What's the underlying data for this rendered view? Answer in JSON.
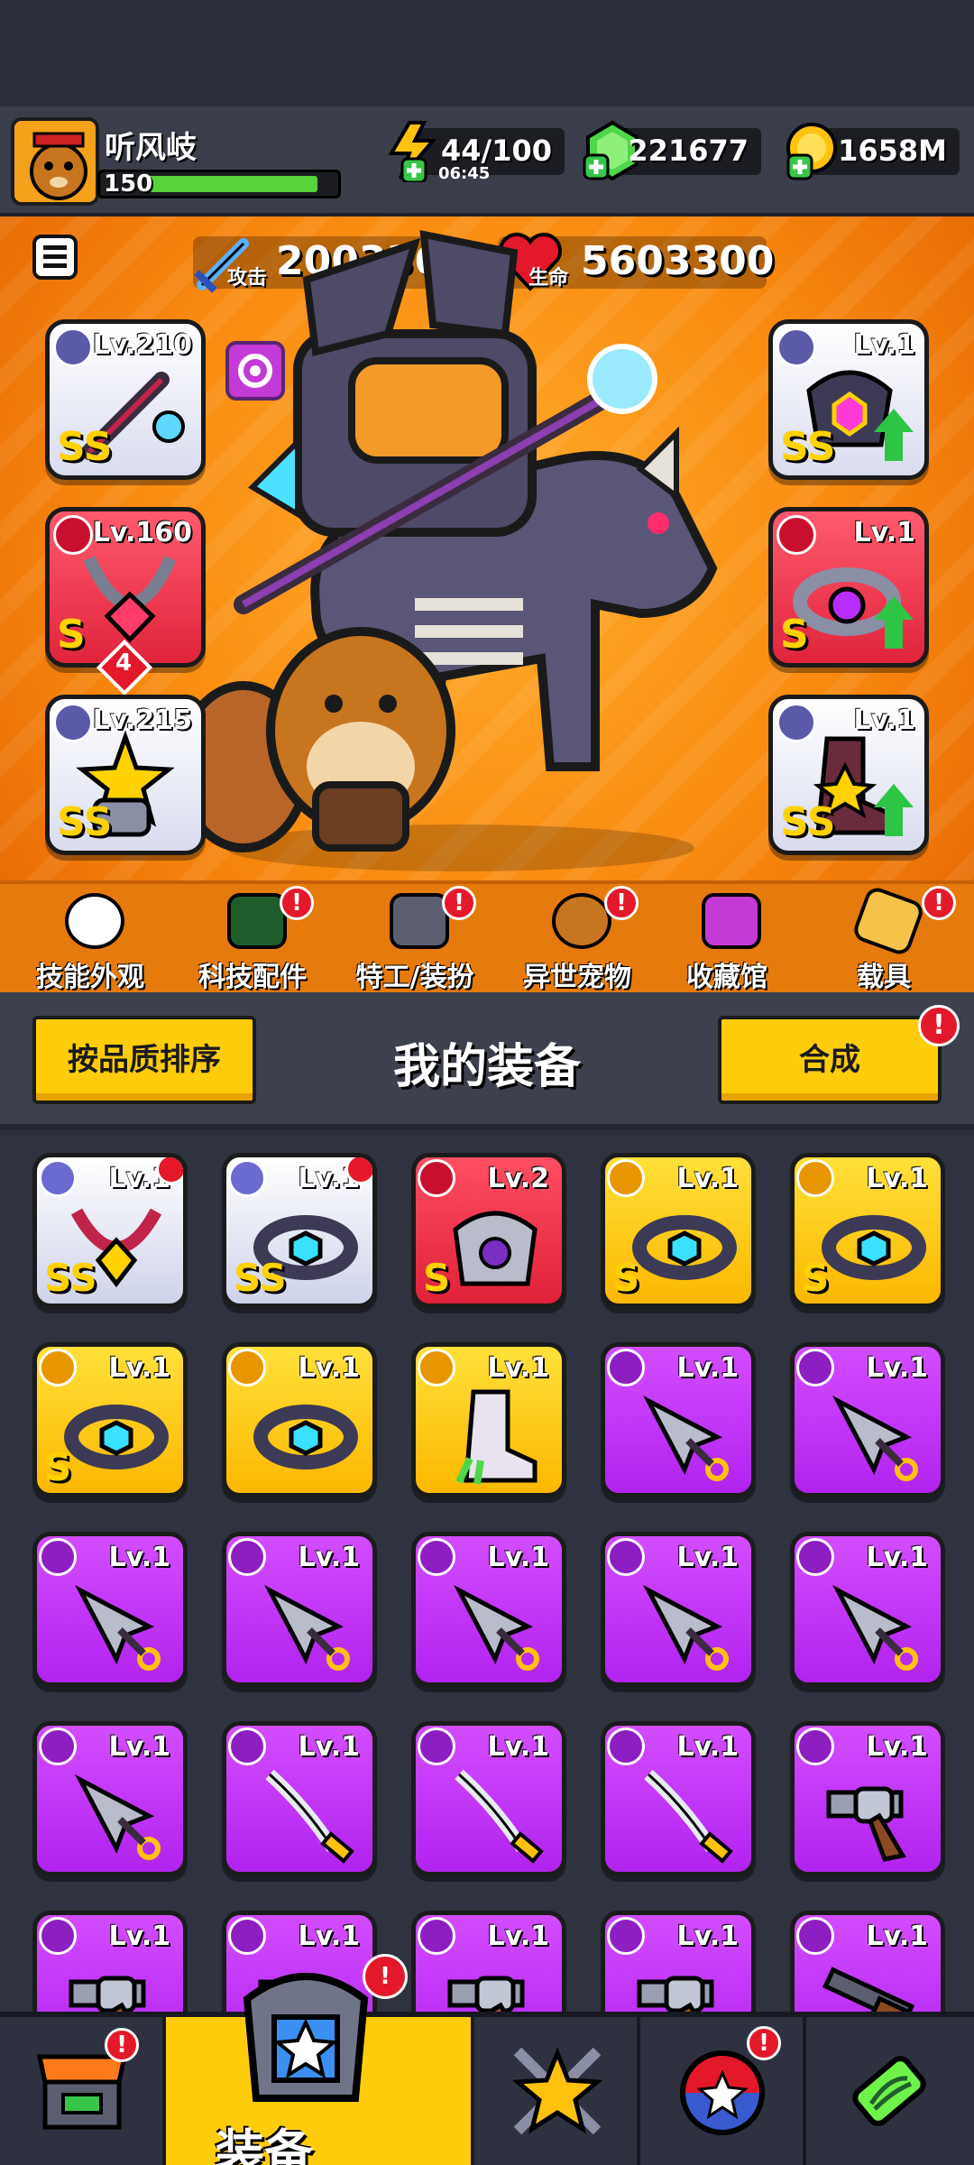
{
  "player": {
    "name": "听风岐",
    "level": "150",
    "xp_fill": 0.9
  },
  "resources": {
    "energy": {
      "value": "44/100",
      "timer": "06:45"
    },
    "gems": {
      "value": "221677"
    },
    "coins": {
      "value": "1658M"
    }
  },
  "stats": {
    "attack": {
      "label": "攻击",
      "value": "2003364"
    },
    "health": {
      "label": "生命",
      "value": "5603300"
    }
  },
  "equipped": {
    "left": [
      {
        "level": "Lv.210",
        "grade": "SS",
        "rarity": "silver",
        "icon": "weapon-staff-icon"
      },
      {
        "level": "Lv.160",
        "grade": "S",
        "rarity": "red",
        "icon": "necklace-icon",
        "stars": "4"
      },
      {
        "level": "Lv.215",
        "grade": "SS",
        "rarity": "silver",
        "icon": "glove-icon"
      }
    ],
    "right": [
      {
        "level": "Lv.1",
        "grade": "SS",
        "rarity": "silver",
        "icon": "armor-icon",
        "upgrade": true
      },
      {
        "level": "Lv.1",
        "grade": "S",
        "rarity": "red",
        "icon": "belt-icon",
        "upgrade": true
      },
      {
        "level": "Lv.1",
        "grade": "SS",
        "rarity": "silver",
        "icon": "boot-icon",
        "upgrade": true
      }
    ]
  },
  "feature_tabs": [
    {
      "label": "技能外观",
      "icon": "skill-skin-icon",
      "badge": false
    },
    {
      "label": "科技配件",
      "icon": "tech-part-icon",
      "badge": true
    },
    {
      "label": "特工/装扮",
      "icon": "agent-costume-icon",
      "badge": true
    },
    {
      "label": "异世宠物",
      "icon": "pet-icon",
      "badge": true
    },
    {
      "label": "收藏馆",
      "icon": "collection-chest-icon",
      "badge": false
    },
    {
      "label": "载具",
      "icon": "vehicle-icon",
      "badge": true
    }
  ],
  "equipment_panel": {
    "sort_button": "按品质排序",
    "title": "我的装备",
    "merge_button": "合成"
  },
  "inventory": [
    {
      "level": "Lv.1",
      "rarity": "silver",
      "grade": "SS",
      "icon": "necklace-icon",
      "new": true
    },
    {
      "level": "Lv.1",
      "rarity": "silver",
      "grade": "SS",
      "icon": "belt-icon",
      "new": true
    },
    {
      "level": "Lv.2",
      "rarity": "red",
      "grade": "S",
      "icon": "armor-icon",
      "new": false
    },
    {
      "level": "Lv.1",
      "rarity": "gold",
      "grade": "S",
      "icon": "belt-icon",
      "new": false
    },
    {
      "level": "Lv.1",
      "rarity": "gold",
      "grade": "S",
      "icon": "belt-icon",
      "new": false
    },
    {
      "level": "Lv.1",
      "rarity": "gold",
      "grade": "S",
      "icon": "belt-icon",
      "new": false
    },
    {
      "level": "Lv.1",
      "rarity": "gold",
      "grade": "",
      "icon": "belt-icon",
      "new": false
    },
    {
      "level": "Lv.1",
      "rarity": "gold",
      "grade": "",
      "icon": "boot-icon",
      "new": false
    },
    {
      "level": "Lv.1",
      "rarity": "purple",
      "grade": "",
      "icon": "kunai-icon",
      "new": false
    },
    {
      "level": "Lv.1",
      "rarity": "purple",
      "grade": "",
      "icon": "kunai-icon",
      "new": false
    },
    {
      "level": "Lv.1",
      "rarity": "purple",
      "grade": "",
      "icon": "kunai-icon",
      "new": false
    },
    {
      "level": "Lv.1",
      "rarity": "purple",
      "grade": "",
      "icon": "kunai-icon",
      "new": false
    },
    {
      "level": "Lv.1",
      "rarity": "purple",
      "grade": "",
      "icon": "kunai-icon",
      "new": false
    },
    {
      "level": "Lv.1",
      "rarity": "purple",
      "grade": "",
      "icon": "kunai-icon",
      "new": false
    },
    {
      "level": "Lv.1",
      "rarity": "purple",
      "grade": "",
      "icon": "kunai-icon",
      "new": false
    },
    {
      "level": "Lv.1",
      "rarity": "purple",
      "grade": "",
      "icon": "kunai-icon",
      "new": false
    },
    {
      "level": "Lv.1",
      "rarity": "purple",
      "grade": "",
      "icon": "saber-icon",
      "new": false
    },
    {
      "level": "Lv.1",
      "rarity": "purple",
      "grade": "",
      "icon": "saber-icon",
      "new": false
    },
    {
      "level": "Lv.1",
      "rarity": "purple",
      "grade": "",
      "icon": "saber-icon",
      "new": false
    },
    {
      "level": "Lv.1",
      "rarity": "purple",
      "grade": "",
      "icon": "revolver-icon",
      "new": false
    },
    {
      "level": "Lv.1",
      "rarity": "purple",
      "grade": "",
      "icon": "revolver-icon",
      "new": false
    },
    {
      "level": "Lv.1",
      "rarity": "purple",
      "grade": "",
      "icon": "revolver-icon",
      "new": false
    },
    {
      "level": "Lv.1",
      "rarity": "purple",
      "grade": "",
      "icon": "revolver-icon",
      "new": false
    },
    {
      "level": "Lv.1",
      "rarity": "purple",
      "grade": "",
      "icon": "revolver-icon",
      "new": false
    },
    {
      "level": "Lv.1",
      "rarity": "purple",
      "grade": "",
      "icon": "rifle-icon",
      "new": false
    }
  ],
  "bottom_nav": [
    {
      "label": "",
      "icon": "shop-icon",
      "badge": true
    },
    {
      "label": "装备",
      "icon": "equipment-icon",
      "badge": true,
      "active": true
    },
    {
      "label": "",
      "icon": "star-swords-icon",
      "badge": false
    },
    {
      "label": "",
      "icon": "gacha-ball-icon",
      "badge": true
    },
    {
      "label": "",
      "icon": "dna-capsule-icon",
      "badge": false
    }
  ],
  "colors": {
    "accent_yellow": "#ffcc0b",
    "hero_orange": "#f98b10",
    "rarity_purple": "#b123ee",
    "rarity_gold": "#fbb800",
    "rarity_red": "#e02139",
    "badge_red": "#e4182b"
  }
}
